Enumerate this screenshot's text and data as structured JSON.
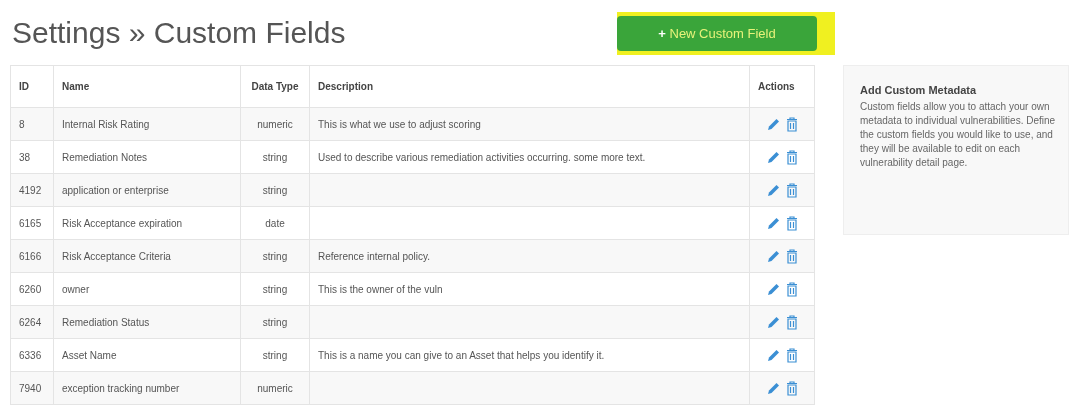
{
  "page_title": "Settings » Custom Fields",
  "new_button": {
    "icon": "+",
    "label": "New Custom Field",
    "highlighted": true
  },
  "table": {
    "columns": [
      "ID",
      "Name",
      "Data Type",
      "Description",
      "Actions"
    ],
    "rows": [
      {
        "id": "8",
        "name": "Internal Risk Rating",
        "type": "numeric",
        "description": "This is what we use to adjust scoring"
      },
      {
        "id": "38",
        "name": "Remediation Notes",
        "type": "string",
        "description": "Used to describe various remediation activities occurring. some more text."
      },
      {
        "id": "4192",
        "name": "application or enterprise",
        "type": "string",
        "description": ""
      },
      {
        "id": "6165",
        "name": "Risk Acceptance expiration",
        "type": "date",
        "description": ""
      },
      {
        "id": "6166",
        "name": "Risk Acceptance Criteria",
        "type": "string",
        "description": "Reference internal policy."
      },
      {
        "id": "6260",
        "name": "owner",
        "type": "string",
        "description": "This is the owner of the vuln"
      },
      {
        "id": "6264",
        "name": "Remediation Status",
        "type": "string",
        "description": ""
      },
      {
        "id": "6336",
        "name": "Asset Name",
        "type": "string",
        "description": "This is a name you can give to an Asset that helps you identify it."
      },
      {
        "id": "7940",
        "name": "exception tracking number",
        "type": "numeric",
        "description": ""
      }
    ]
  },
  "sidebar": {
    "title": "Add Custom Metadata",
    "text": "Custom fields allow you to attach your own metadata to individual vulnerabilities. Define the custom fields you would like to use, and they will be available to edit on each vulnerability detail page."
  }
}
